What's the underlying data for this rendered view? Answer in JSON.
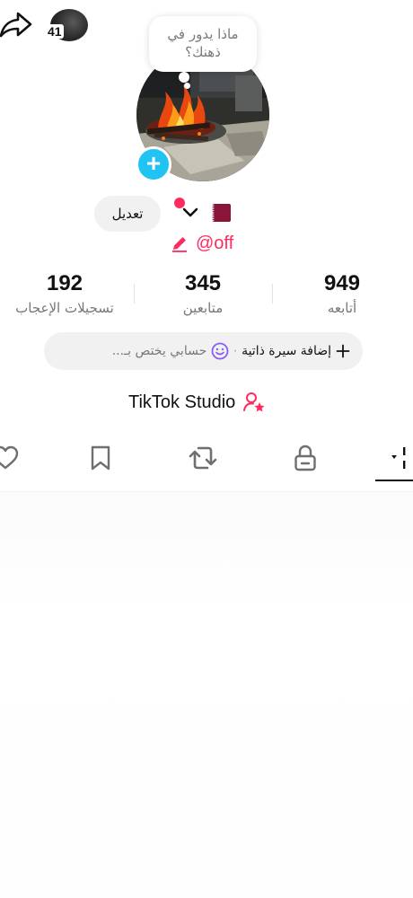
{
  "header": {
    "share_icon": "share-arrow-icon",
    "mini_avatar_count": "41"
  },
  "profile": {
    "note_text": "ماذا يدور في ذهنك؟",
    "add_icon": "plus-icon",
    "edit_label": "تعديل",
    "flag": "qatar-flag-icon",
    "username": "@off"
  },
  "stats": {
    "likes": {
      "value": "192",
      "label": "تسجيلات الإعجاب"
    },
    "followers": {
      "value": "345",
      "label": "متابعين"
    },
    "following": {
      "value": "949",
      "label": "أتابعه"
    }
  },
  "bio": {
    "add_label": "إضافة سيرة ذاتية",
    "separator": "·",
    "hint": "حسابي يختص بـ..."
  },
  "studio": {
    "label": "TikTok Studio",
    "icon": "user-star-icon"
  },
  "tabs": [
    {
      "name": "liked",
      "icon": "heart-icon"
    },
    {
      "name": "favorites",
      "icon": "bookmark-icon"
    },
    {
      "name": "reposts",
      "icon": "repost-icon"
    },
    {
      "name": "private",
      "icon": "lock-icon"
    },
    {
      "name": "videos",
      "icon": "grid-dropdown-icon",
      "active": true
    }
  ],
  "colors": {
    "accent": "#ff2b5e",
    "add_badge": "#20c3f2",
    "smile": "#8a5cf6",
    "muted_text": "#777777"
  }
}
